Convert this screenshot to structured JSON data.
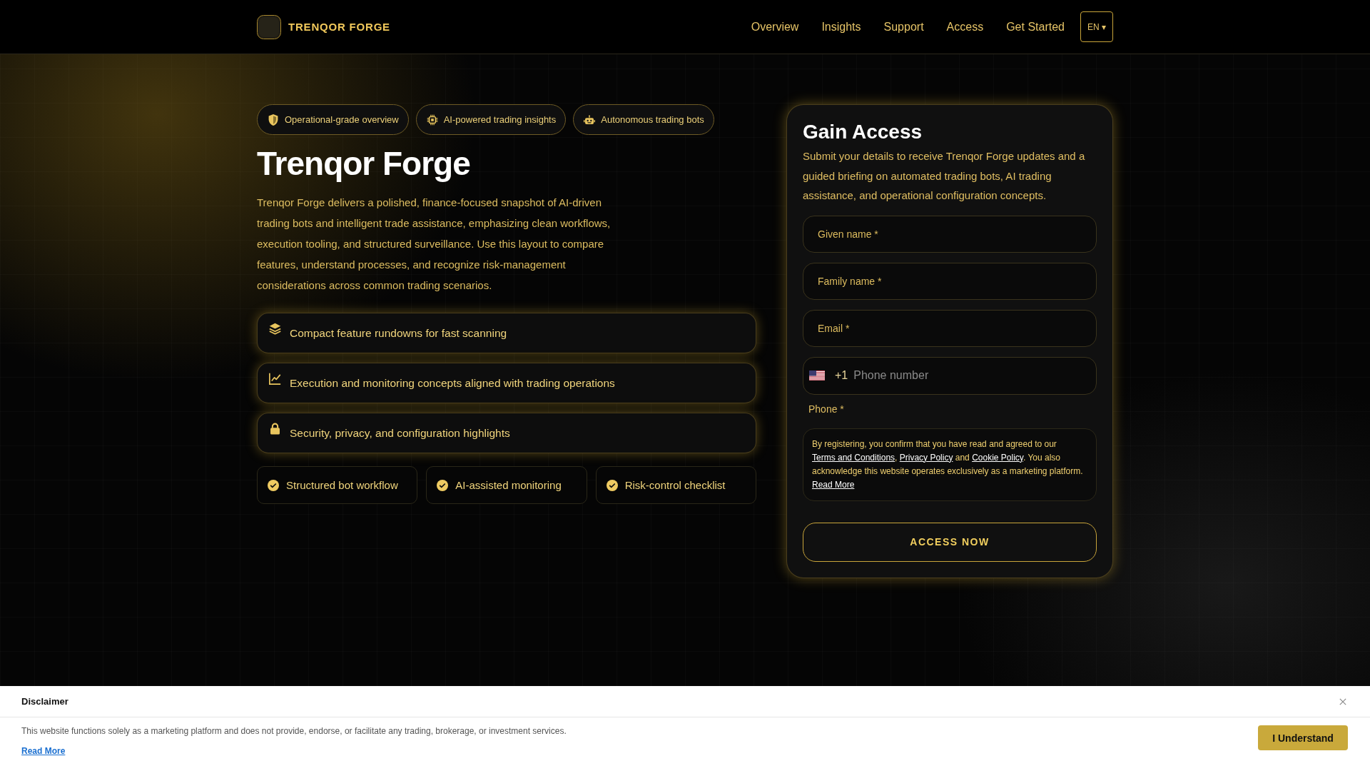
{
  "header": {
    "brand": "TRENQOR FORGE",
    "nav": [
      "Overview",
      "Insights",
      "Support",
      "Access",
      "Get Started"
    ],
    "language": "EN ▾"
  },
  "hero": {
    "tags": [
      {
        "label": "Operational-grade overview"
      },
      {
        "label": "AI-powered trading insights"
      },
      {
        "label": "Autonomous trading bots"
      }
    ],
    "title": "Trenqor Forge",
    "description": "Trenqor Forge delivers a polished, finance-focused snapshot of AI-driven trading bots and intelligent trade assistance, emphasizing clean workflows, execution tooling, and structured surveillance. Use this layout to compare features, understand processes, and recognize risk-management considerations across common trading scenarios.",
    "features": [
      {
        "text": "Compact feature rundowns for fast scanning"
      },
      {
        "text": "Execution and monitoring concepts aligned with trading operations"
      },
      {
        "text": "Security, privacy, and configuration highlights"
      }
    ],
    "checks": [
      {
        "text": "Structured bot workflow"
      },
      {
        "text": "AI-assisted monitoring"
      },
      {
        "text": "Risk-control checklist"
      }
    ]
  },
  "form": {
    "title": "Gain Access",
    "intro": "Submit your details to receive Trenqor Forge updates and a guided briefing on automated trading bots, AI trading assistance, and operational configuration concepts.",
    "fields": [
      {
        "placeholder": "Given name *"
      },
      {
        "placeholder": "Family name *"
      },
      {
        "placeholder": "Email *"
      }
    ],
    "phone": {
      "dial_code": "+1",
      "placeholder": "Phone number",
      "label": "Phone *"
    },
    "consent": [
      {
        "kind": "text",
        "text": "By registering, you confirm that you have read and agreed to our "
      },
      {
        "kind": "link",
        "text": "Terms and Conditions"
      },
      {
        "kind": "text",
        "text": ", "
      },
      {
        "kind": "link",
        "text": "Privacy Policy"
      },
      {
        "kind": "text",
        "text": " and "
      },
      {
        "kind": "link",
        "text": "Cookie Policy"
      },
      {
        "kind": "text",
        "text": ". You also acknowledge this website operates exclusively as a marketing platform. "
      },
      {
        "kind": "link",
        "text": "Read More"
      }
    ],
    "submit": "ACCESS NOW"
  },
  "disclaimer": {
    "title": "Disclaimer",
    "text": "This website functions solely as a marketing platform and does not provide, endorse, or facilitate any trading, brokerage, or investment services.",
    "link": "Read More",
    "button": "I Understand"
  }
}
